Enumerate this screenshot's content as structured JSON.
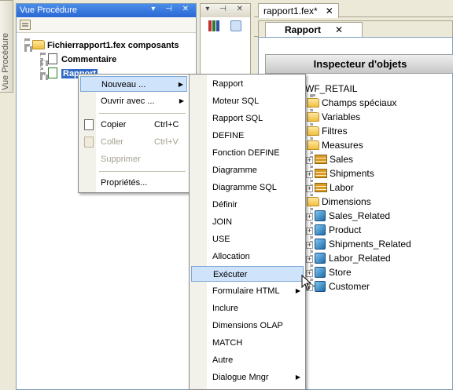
{
  "side_tab": {
    "label": "Vue Procédure"
  },
  "procedure_panel": {
    "title": "Vue Procédure",
    "controls": "▾ ⊣ ✕",
    "tree": {
      "root": "Fichierrapport1.fex composants",
      "children": [
        "Commentaire",
        "Rapport"
      ]
    }
  },
  "middle_panel": {
    "controls": "▾ ⊣ ✕"
  },
  "editor": {
    "doc_tab": "rapport1.fex*",
    "inner_tab": "Rapport",
    "close_glyph": "✕"
  },
  "inspector": {
    "header": "Inspecteur d'objets",
    "root": "WF_RETAIL",
    "folders_top": [
      "Champs spéciaux",
      "Variables",
      "Filtres",
      "Measures"
    ],
    "measures": [
      "Sales",
      "Shipments",
      "Labor"
    ],
    "dimensions_label": "Dimensions",
    "dimensions": [
      "Sales_Related",
      "Product",
      "Shipments_Related",
      "Labor_Related",
      "Store",
      "Customer"
    ]
  },
  "context_menu": {
    "items": [
      {
        "label": "Nouveau ...",
        "shortcut": "",
        "submenu": true,
        "enabled": true,
        "highlighted": true
      },
      {
        "label": "Ouvrir avec ...",
        "shortcut": "",
        "submenu": true,
        "enabled": true
      },
      {
        "label": "Copier",
        "shortcut": "Ctrl+C",
        "submenu": false,
        "enabled": true
      },
      {
        "label": "Coller",
        "shortcut": "Ctrl+V",
        "submenu": false,
        "enabled": false
      },
      {
        "label": "Supprimer",
        "shortcut": "",
        "submenu": false,
        "enabled": false
      },
      {
        "label": "Propriétés...",
        "shortcut": "",
        "submenu": false,
        "enabled": true
      }
    ]
  },
  "submenu": {
    "items": [
      "Rapport",
      "Moteur SQL",
      "Rapport SQL",
      "DEFINE",
      "Fonction DEFINE",
      "Diagramme",
      "Diagramme SQL",
      "Définir",
      "JOIN",
      "USE",
      "Allocation",
      "Exécuter",
      "Formulaire HTML",
      "Inclure",
      "Dimensions OLAP",
      "MATCH",
      "Autre",
      "Dialogue Mngr"
    ],
    "highlighted": "Exécuter",
    "with_arrow": [
      "Formulaire HTML",
      "Dialogue Mngr"
    ]
  },
  "colors": {
    "title_bar": "#2a68d4",
    "selection": "#316ac5",
    "menu_highlight": "#cfe3fb"
  }
}
